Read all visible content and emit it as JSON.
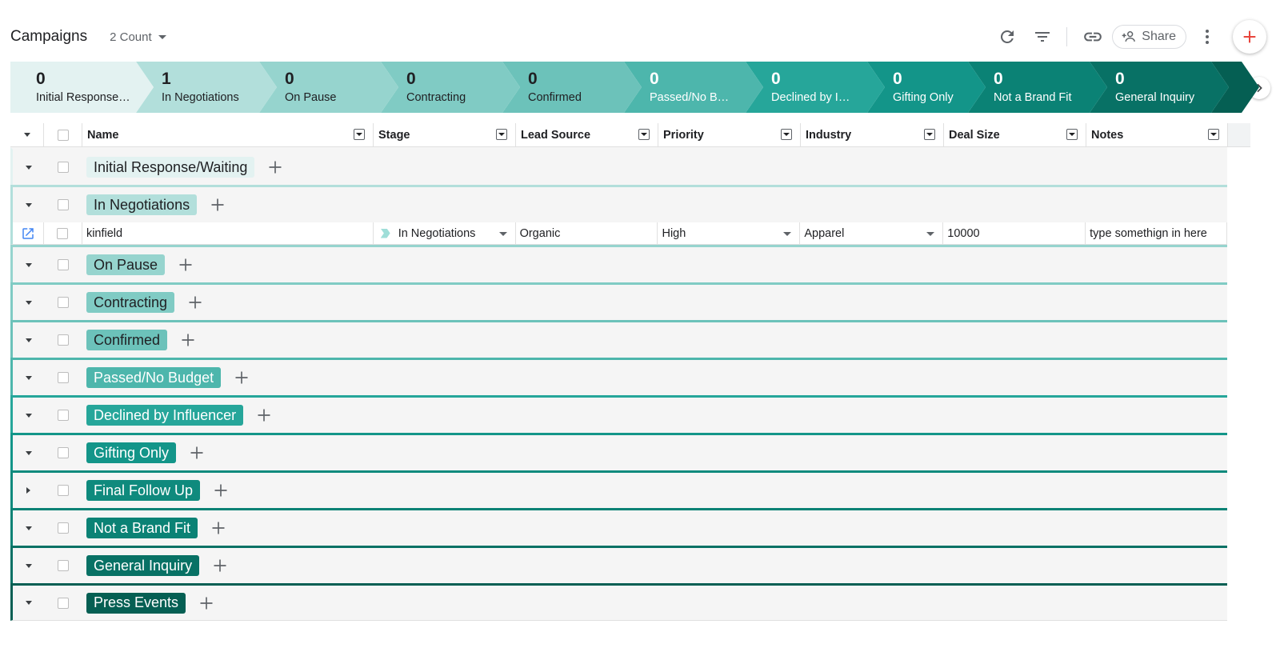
{
  "header": {
    "title": "Campaigns",
    "count_label": "2 Count",
    "share_label": "Share"
  },
  "pipeline": [
    {
      "count": "0",
      "label": "Initial Response…",
      "bg": "#e3f2f1",
      "fg": "#202124"
    },
    {
      "count": "1",
      "label": "In Negotiations",
      "bg": "#b2dfdb",
      "fg": "#202124"
    },
    {
      "count": "0",
      "label": "On Pause",
      "bg": "#96d4ce",
      "fg": "#202124"
    },
    {
      "count": "0",
      "label": "Contracting",
      "bg": "#80cbc4",
      "fg": "#202124"
    },
    {
      "count": "0",
      "label": "Confirmed",
      "bg": "#6cc2ba",
      "fg": "#202124"
    },
    {
      "count": "0",
      "label": "Passed/No B…",
      "bg": "#4db6ac",
      "fg": "#ffffff"
    },
    {
      "count": "0",
      "label": "Declined by I…",
      "bg": "#26a69a",
      "fg": "#ffffff"
    },
    {
      "count": "0",
      "label": "Gifting Only",
      "bg": "#139589",
      "fg": "#ffffff"
    },
    {
      "count": "0",
      "label": "Not a Brand Fit",
      "bg": "#0b8275",
      "fg": "#ffffff"
    },
    {
      "count": "0",
      "label": "General Inquiry",
      "bg": "#087165",
      "fg": "#ffffff"
    },
    {
      "count": "",
      "label": "",
      "bg": "#055f53",
      "fg": "#ffffff"
    }
  ],
  "columns": {
    "name": "Name",
    "stage": "Stage",
    "lead_source": "Lead Source",
    "priority": "Priority",
    "industry": "Industry",
    "deal_size": "Deal Size",
    "notes": "Notes"
  },
  "groups": [
    {
      "label": "Initial Response/Waiting",
      "bg": "#e3f2f1",
      "fg": "#202124",
      "border": "#e3f2f1",
      "expanded": true
    },
    {
      "label": "In Negotiations",
      "bg": "#b2dfdb",
      "fg": "#202124",
      "border": "#b2dfdb",
      "expanded": true
    },
    {
      "label": "On Pause",
      "bg": "#96d4ce",
      "fg": "#202124",
      "border": "#96d4ce",
      "expanded": true
    },
    {
      "label": "Contracting",
      "bg": "#80cbc4",
      "fg": "#202124",
      "border": "#80cbc4",
      "expanded": true
    },
    {
      "label": "Confirmed",
      "bg": "#6cc2ba",
      "fg": "#202124",
      "border": "#6cc2ba",
      "expanded": true
    },
    {
      "label": "Passed/No Budget",
      "bg": "#4db6ac",
      "fg": "#ffffff",
      "border": "#4db6ac",
      "expanded": true
    },
    {
      "label": "Declined by Influencer",
      "bg": "#26a69a",
      "fg": "#ffffff",
      "border": "#26a69a",
      "expanded": true
    },
    {
      "label": "Gifting Only",
      "bg": "#139589",
      "fg": "#ffffff",
      "border": "#139589",
      "expanded": true
    },
    {
      "label": "Final Follow Up",
      "bg": "#0f8a7d",
      "fg": "#ffffff",
      "border": "#0f8a7d",
      "expanded": false
    },
    {
      "label": "Not a Brand Fit",
      "bg": "#0b8275",
      "fg": "#ffffff",
      "border": "#0b8275",
      "expanded": true
    },
    {
      "label": "General Inquiry",
      "bg": "#087165",
      "fg": "#ffffff",
      "border": "#087165",
      "expanded": true
    },
    {
      "label": "Press Events",
      "bg": "#055f53",
      "fg": "#ffffff",
      "border": "#055f53",
      "expanded": true
    }
  ],
  "row": {
    "name": "kinfield",
    "stage": "In Negotiations",
    "lead_source": "Organic",
    "priority": "High",
    "industry": "Apparel",
    "deal_size": "10000",
    "notes": "type somethign in here"
  },
  "colors": {
    "accent_red": "#e8453c",
    "icon_gray": "#5f6368",
    "open_icon": "#4285f4"
  }
}
